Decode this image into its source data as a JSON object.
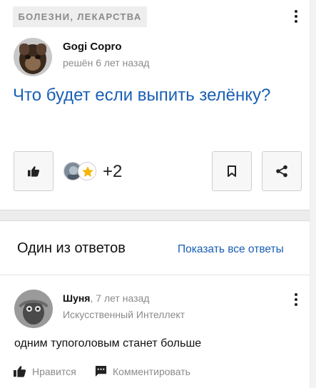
{
  "question": {
    "category": "БОЛЕЗНИ, ЛЕКАРСТВА",
    "author": "Gogi Copro",
    "time": "решён 6 лет назад",
    "title": "Что будет если выпить зелёнку?",
    "extra_likes": "+2"
  },
  "answers": {
    "heading": "Один из ответов",
    "show_all": "Показать все ответы"
  },
  "answer": {
    "author": "Шуня",
    "time": ", 7 лет назад",
    "rank": "Искусственный Интеллект",
    "text": "одним тупоголовым станет больше",
    "like_label": "Нравится",
    "comment_label": "Комментировать"
  },
  "icons": {
    "like": "thumbs-up-icon",
    "bookmark": "bookmark-icon",
    "share": "share-icon",
    "comment": "comment-icon",
    "more": "more-vertical-icon",
    "star": "star-icon"
  },
  "colors": {
    "link": "#1a5fb4",
    "muted": "#8b8b8b",
    "star": "#f4b400"
  }
}
